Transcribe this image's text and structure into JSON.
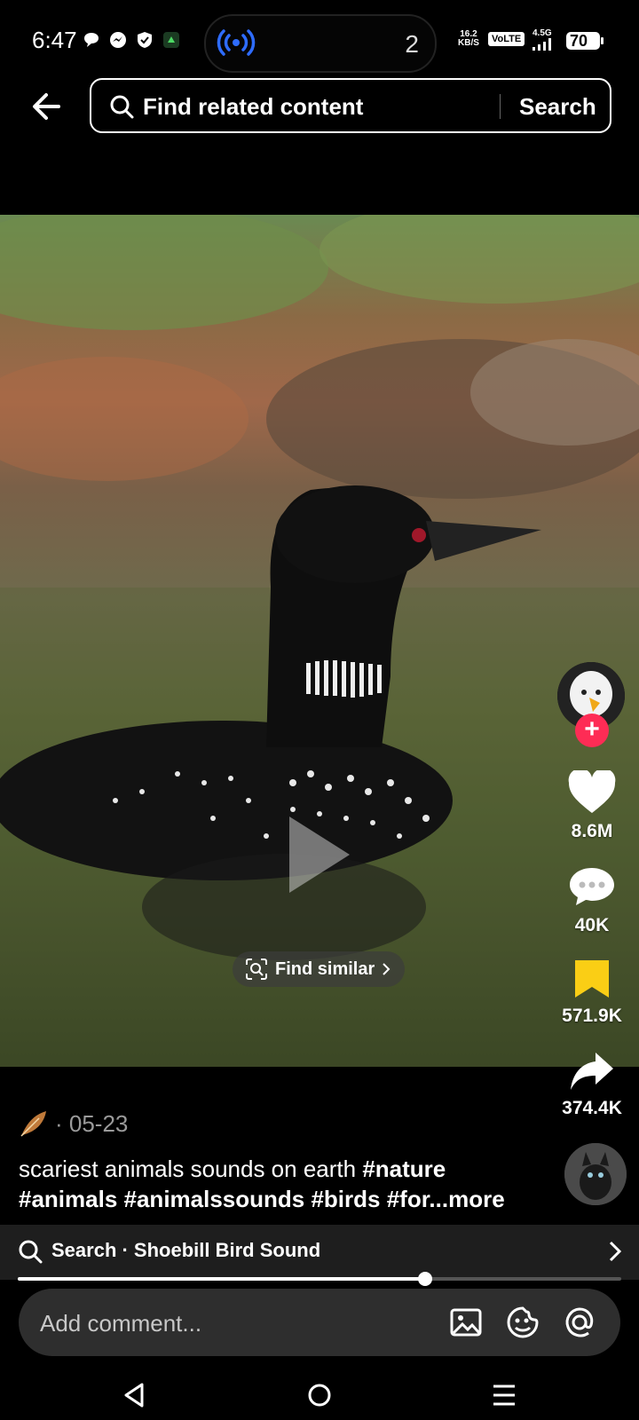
{
  "status_bar": {
    "time": "6:47",
    "island_count": "2",
    "net_speed_value": "16.2",
    "net_speed_unit": "KB/S",
    "volte": "VoLTE",
    "signal": "4.5G",
    "battery": "70"
  },
  "top_search": {
    "placeholder": "Find related content",
    "button_label": "Search"
  },
  "video": {
    "find_similar_label": "Find similar"
  },
  "rail": {
    "likes": "8.6M",
    "comments": "40K",
    "saves": "571.9K",
    "shares": "374.4K"
  },
  "post": {
    "date": "· 05-23",
    "caption_text": "scariest animals sounds on earth ",
    "caption_tags": "#nature #animals #animalssounds #birds #for",
    "caption_more": "...more"
  },
  "search_suggestion": {
    "label": "Search · Shoebill Bird Sound"
  },
  "playback": {
    "progress_fraction": 0.675
  },
  "comment": {
    "placeholder": "Add comment..."
  },
  "colors": {
    "accent_red": "#fe2c55",
    "save_yellow": "#face15"
  }
}
